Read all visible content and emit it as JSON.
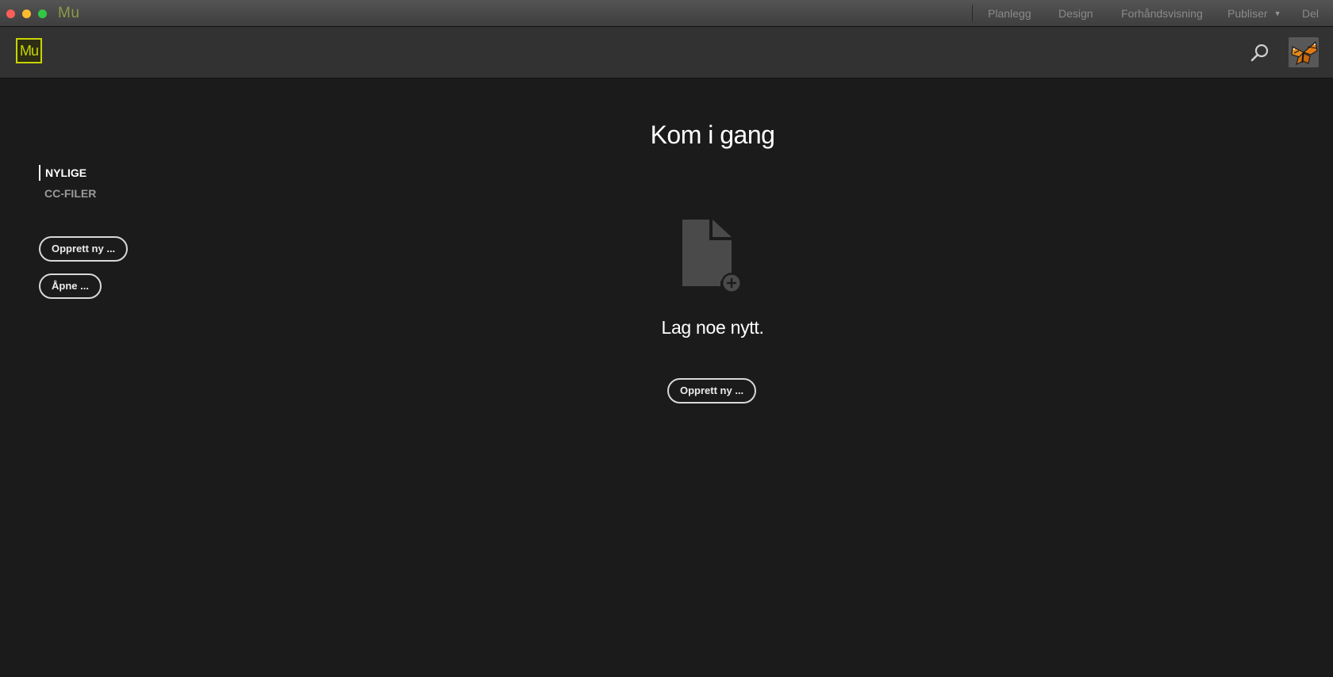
{
  "titlebar": {
    "app_name": "Mu",
    "tabs": [
      {
        "label": "Planlegg"
      },
      {
        "label": "Design"
      },
      {
        "label": "Forhåndsvisning"
      },
      {
        "label": "Publiser"
      },
      {
        "label": "Del"
      }
    ]
  },
  "header": {
    "logo_text": "Mu",
    "search_icon": "search-icon",
    "avatar_icon": "butterfly-avatar"
  },
  "sidebar": {
    "items": [
      {
        "label": "NYLIGE",
        "active": true
      },
      {
        "label": "CC-FILER",
        "active": false
      }
    ],
    "create_button": "Opprett ny ...",
    "open_button": "Åpne ..."
  },
  "main": {
    "title": "Kom i gang",
    "icon": "new-document-icon",
    "subtitle": "Lag noe nytt.",
    "create_button": "Opprett ny ..."
  },
  "colors": {
    "accent": "#c8d400",
    "background": "#1b1b1b",
    "header": "#323232"
  }
}
